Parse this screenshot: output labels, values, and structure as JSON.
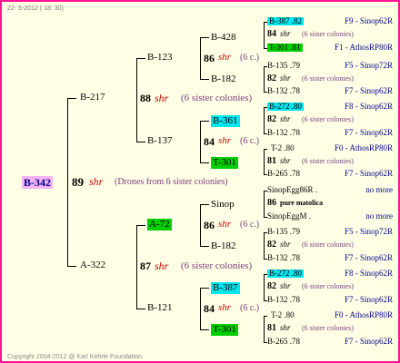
{
  "header": {
    "date": "22-  5-2012 ( 18: 30)"
  },
  "footer": {
    "copyright": "Copyright 2004-2012 @ Karl Kehrle Foundation."
  },
  "colors": {
    "frame": "#ff1493",
    "background": "#ffffe6",
    "cyan_badge": "#00e5ee",
    "green_badge": "#00d000",
    "root_badge": "#f5b3f5",
    "note": "#7a3a7a",
    "shr": "#cc0000",
    "right_label": "#00008b"
  },
  "root": {
    "id": "B-342",
    "num": "89",
    "shr": "shr",
    "note": "(Drones from 6 sister colonies)"
  },
  "g2": {
    "b217": {
      "id": "B-217",
      "num": "88",
      "shr": "shr",
      "note": "(6 sister colonies)"
    },
    "a322": {
      "id": "A-322",
      "num": "87",
      "shr": "shr",
      "note": "(6 sister colonies)"
    }
  },
  "g3": {
    "b123": {
      "id": "B-123",
      "num": "86",
      "shr": "shr",
      "note": "(6 c.)"
    },
    "b137": {
      "id": "B-137",
      "num": "84",
      "shr": "shr",
      "note": "(6 c.)"
    },
    "a72": {
      "id": "A-72",
      "num": "86",
      "shr": "shr",
      "note": "(6 c.)"
    },
    "b121": {
      "id": "B-121",
      "num": "84",
      "shr": "shr",
      "note": "(6 c.)"
    }
  },
  "g4": {
    "b428": "B-428",
    "b182a": "B-182",
    "b361": "B-361",
    "t301a": "T-301",
    "sinop": "Sinop",
    "b182b": "B-182",
    "b387": "B-387",
    "t301b": "T-301"
  },
  "g5": [
    {
      "a": "B-387 .82",
      "b": "84",
      "shr": "shr",
      "c": "(6 sister colonies)",
      "d": "T-301 .81",
      "r1": "F9 - Sinop62R",
      "r3": "F1 - AthosRP80R"
    },
    {
      "a": "B-135 .79",
      "b": "82",
      "shr": "shr",
      "c": "(6 sister colonies)",
      "d": "B-132 .78",
      "r1": "F5 - Sinop72R",
      "r3": "F7 - Sinop62R"
    },
    {
      "a": "B-272 .80",
      "b": "82",
      "shr": "shr",
      "c": "(6 sister colonies)",
      "d": "B-132 .78",
      "r1": "F8 - Sinop62R",
      "r3": "F7 - Sinop62R"
    },
    {
      "a": "T-2 .80",
      "b": "81",
      "shr": "shr",
      "c": "(6 sister colonies)",
      "d": "B-265 .78",
      "r1": "F0 - AthosRP80R",
      "r3": "F7 - Sinop62R"
    },
    {
      "a": "SinopEgg86R .",
      "b": "86",
      "shr": "",
      "c": "pure matolica",
      "d": "SinopEggM .",
      "r1": "no more",
      "r3": "no more"
    },
    {
      "a": "B-135 .79",
      "b": "82",
      "shr": "shr",
      "c": "(6 sister colonies)",
      "d": "B-132 .78",
      "r1": "F5 - Sinop72R",
      "r3": "F7 - Sinop62R"
    },
    {
      "a": "B-272 .80",
      "b": "82",
      "shr": "shr",
      "c": "(6 sister colonies)",
      "d": "B-132 .78",
      "r1": "F8 - Sinop62R",
      "r3": "F7 - Sinop62R"
    },
    {
      "a": "T-2 .80",
      "b": "81",
      "shr": "shr",
      "c": "(6 sister colonies)",
      "d": "B-265 .78",
      "r1": "F0 - AthosRP80R",
      "r3": "F7 - Sinop62R"
    }
  ]
}
